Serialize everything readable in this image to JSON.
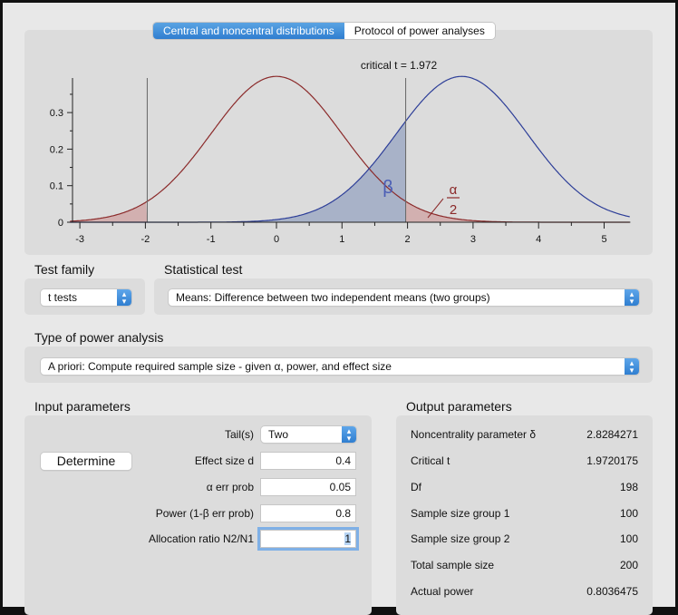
{
  "tabs": [
    {
      "label": "Central and noncentral distributions",
      "active": true
    },
    {
      "label": "Protocol of power analyses",
      "active": false
    }
  ],
  "chart_data": {
    "type": "line",
    "annotation": "critical t = 1.972",
    "critical_t": 1.972,
    "central": {
      "mean": 0,
      "df": 198,
      "color": "#8b2a2a",
      "fill": "#d2b0b0"
    },
    "noncentral": {
      "noncentrality": 2.8284271,
      "df": 198,
      "color": "#2d3e98",
      "fill": "#a8b2c8"
    },
    "xlim": [
      -3.15,
      5.4
    ],
    "ylim": [
      0,
      0.39
    ],
    "x_ticks": [
      "-3",
      "-2",
      "-1",
      "0",
      "1",
      "2",
      "3",
      "4",
      "5"
    ],
    "y_ticks": [
      "0",
      "0.1",
      "0.2",
      "0.3"
    ],
    "beta_label": "β",
    "alpha_label": {
      "num": "α",
      "den": "2"
    }
  },
  "test_family": {
    "label": "Test family",
    "value": "t tests"
  },
  "statistical_test": {
    "label": "Statistical test",
    "value": "Means: Difference between two independent means (two groups)"
  },
  "power_analysis": {
    "label": "Type of power analysis",
    "value": "A priori: Compute required sample size - given α, power, and effect size"
  },
  "input": {
    "title": "Input parameters",
    "determine": "Determine",
    "tails": {
      "label": "Tail(s)",
      "value": "Two"
    },
    "effect_size": {
      "label": "Effect size d",
      "value": "0.4"
    },
    "alpha": {
      "label": "α err prob",
      "value": "0.05"
    },
    "power": {
      "label": "Power (1-β err prob)",
      "value": "0.8"
    },
    "allocation": {
      "label": "Allocation ratio N2/N1",
      "value": "1"
    }
  },
  "output": {
    "title": "Output parameters",
    "rows": [
      {
        "label": "Noncentrality parameter δ",
        "value": "2.8284271"
      },
      {
        "label": "Critical t",
        "value": "1.9720175"
      },
      {
        "label": "Df",
        "value": "198"
      },
      {
        "label": "Sample size group 1",
        "value": "100"
      },
      {
        "label": "Sample size group 2",
        "value": "100"
      },
      {
        "label": "Total sample size",
        "value": "200"
      },
      {
        "label": "Actual power",
        "value": "0.8036475"
      }
    ]
  }
}
